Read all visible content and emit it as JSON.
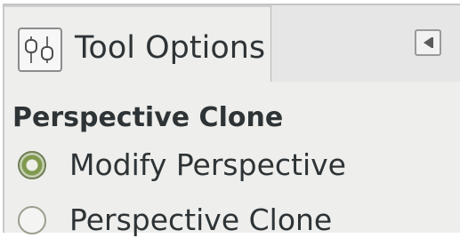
{
  "dock": {
    "tab": {
      "label": "Tool Options",
      "icon": "tool-options-icon"
    },
    "menu_button_icon": "dock-menu-arrow-icon"
  },
  "tool_options": {
    "tool_name": "Perspective Clone",
    "modes": [
      {
        "label": "Modify Perspective",
        "checked": true
      },
      {
        "label": "Perspective Clone",
        "checked": false
      }
    ]
  }
}
